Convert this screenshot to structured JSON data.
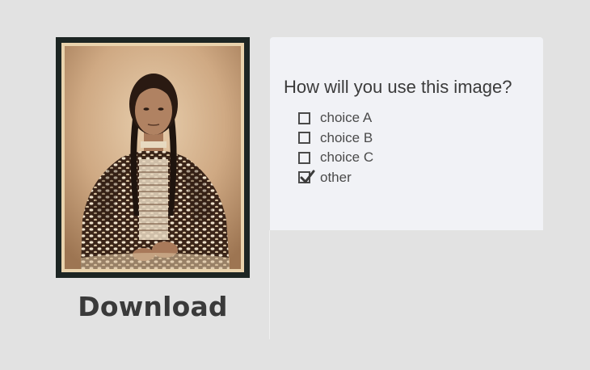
{
  "image": {
    "description_icon": "portrait-photo"
  },
  "download": {
    "label": "Download"
  },
  "survey": {
    "question": "How will you use this image?",
    "choices": [
      {
        "label": "choice A",
        "checked": false
      },
      {
        "label": "choice B",
        "checked": false
      },
      {
        "label": "choice C",
        "checked": false
      },
      {
        "label": "other",
        "checked": true
      }
    ]
  },
  "colors": {
    "background": "#e2e2e2",
    "card": "#f1f2f6",
    "text": "#3b3b3b",
    "frame": "#1c2523",
    "sepia": "#c9a27a"
  }
}
